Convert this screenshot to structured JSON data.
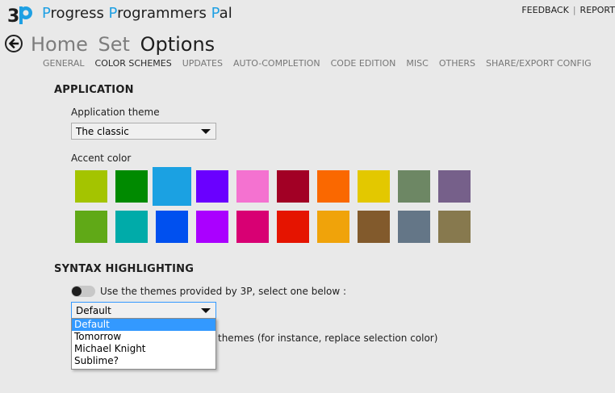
{
  "app": {
    "title_parts": [
      {
        "text": "P",
        "accent": true
      },
      {
        "text": "rogress ",
        "accent": false
      },
      {
        "text": "P",
        "accent": true
      },
      {
        "text": "rogrammers ",
        "accent": false
      },
      {
        "text": "P",
        "accent": true
      },
      {
        "text": "al",
        "accent": false
      }
    ],
    "logo_text": "3P"
  },
  "toplinks": {
    "feedback": "FEEDBACK",
    "separator": "|",
    "report": "REPORT"
  },
  "breadcrumb": {
    "home": "Home",
    "set": "Set",
    "current": "Options"
  },
  "tabs": [
    {
      "label": "GENERAL",
      "active": false
    },
    {
      "label": "COLOR SCHEMES",
      "active": true
    },
    {
      "label": "UPDATES",
      "active": false
    },
    {
      "label": "AUTO-COMPLETION",
      "active": false
    },
    {
      "label": "CODE EDITION",
      "active": false
    },
    {
      "label": "MISC",
      "active": false
    },
    {
      "label": "OTHERS",
      "active": false
    },
    {
      "label": "SHARE/EXPORT CONFIG",
      "active": false
    }
  ],
  "application": {
    "header": "APPLICATION",
    "theme_label": "Application theme",
    "theme_value": "The classic",
    "accent_label": "Accent color",
    "accent_colors": [
      [
        "#a4c400",
        "#008a00",
        "#1ba1e2",
        "#6a00ff",
        "#f472d0",
        "#a20025",
        "#fa6800",
        "#e3c800",
        "#6d8764",
        "#76608a"
      ],
      [
        "#60a917",
        "#00aba9",
        "#0050ef",
        "#aa00ff",
        "#d80073",
        "#e51400",
        "#f0a30a",
        "#825a2c",
        "#647687",
        "#87794e"
      ]
    ],
    "selected_accent": "#1ba1e2"
  },
  "syntax": {
    "header": "SYNTAX HIGHLIGHTING",
    "toggle_label": "Use the themes provided by 3P, select one below :",
    "theme_value": "Default",
    "options": [
      "Default",
      "Tomorrow",
      "Michael Knight",
      "Sublime?"
    ],
    "selected_index": 0,
    "hidden_text_tail": "themes (for instance, replace selection color)"
  }
}
